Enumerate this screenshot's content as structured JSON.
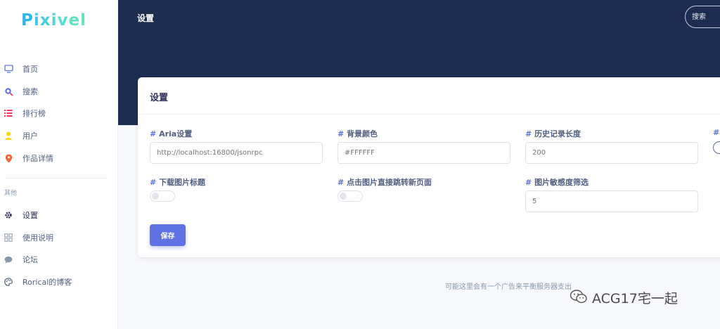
{
  "app": {
    "logo": "Pixivel"
  },
  "sidebar": {
    "items": [
      {
        "label": "首页",
        "icon": "monitor-icon"
      },
      {
        "label": "搜索",
        "icon": "search-icon"
      },
      {
        "label": "排行榜",
        "icon": "list-icon"
      },
      {
        "label": "用户",
        "icon": "user-icon"
      },
      {
        "label": "作品详情",
        "icon": "location-pin-icon"
      }
    ],
    "section_label": "其他",
    "extra_items": [
      {
        "label": "设置",
        "icon": "gear-icon"
      },
      {
        "label": "使用说明",
        "icon": "manual-icon"
      },
      {
        "label": "论坛",
        "icon": "chat-icon"
      },
      {
        "label": "Rorical的博客",
        "icon": "palette-icon"
      }
    ]
  },
  "header": {
    "title": "设置",
    "search_placeholder": "搜索"
  },
  "settings": {
    "title": "设置",
    "aria": {
      "label": "Aria设置",
      "value": "http://localhost:16800/jsonrpc"
    },
    "bg_color": {
      "label": "背景颜色",
      "value": "#FFFFFF"
    },
    "history": {
      "label": "历史记录长度",
      "value": "200"
    },
    "download_title": {
      "label": "下载图片标题"
    },
    "open_new_page": {
      "label": "点击图片直接跳转新页面"
    },
    "sensitivity": {
      "label": "图片敏感度筛选",
      "value": "5"
    },
    "save_label": "保存"
  },
  "footer": {
    "ad_text": "可能这里会有一个广告来平衡服务器支出",
    "watermark": "ACG17宅一起"
  },
  "colors": {
    "primary": "#5e72e4",
    "header_bg": "#1d2d4f",
    "logo": "#3ec7e6"
  }
}
